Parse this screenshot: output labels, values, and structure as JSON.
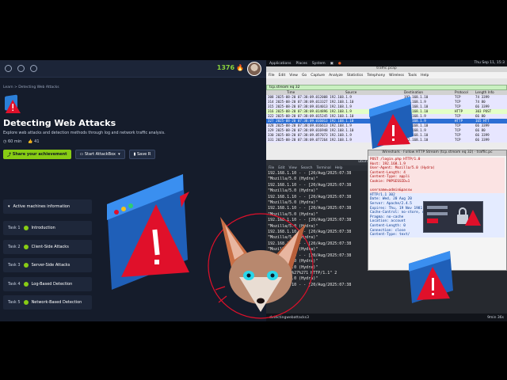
{
  "left": {
    "streak_count": "1376",
    "breadcrumb": "Learn > Detecting Web Attacks",
    "title": "Detecting Web Attacks",
    "description": "Explore web attacks and detection methods through log and network traffic analysis.",
    "duration": "60 min",
    "rating_count": "41",
    "share_label": "Share your achievement",
    "attackbox_label": "Start AttackBox",
    "save_label": "Save R",
    "active_machines_label": "Active machines information",
    "tasks": [
      {
        "num": "Task 1",
        "label": "Introduction"
      },
      {
        "num": "Task 2",
        "label": "Client-Side Attacks"
      },
      {
        "num": "Task 3",
        "label": "Server-Side Attacks"
      },
      {
        "num": "Task 4",
        "label": "Log-Based Detection"
      },
      {
        "num": "Task 5",
        "label": "Network-Based Detection"
      }
    ]
  },
  "kali": {
    "menu": [
      "Applications",
      "Places",
      "System"
    ],
    "clock": "Thu Sep 11, 15:3",
    "wireshark_title": "traffic.pcap",
    "ws_menu": [
      "File",
      "Edit",
      "View",
      "Go",
      "Capture",
      "Analyze",
      "Statistics",
      "Telephony",
      "Wireless",
      "Tools",
      "Help"
    ],
    "filter": "tcp.stream eq 32",
    "columns": [
      "Time",
      "Source",
      "Destination",
      "Protocol",
      "Length Info"
    ],
    "packets": [
      {
        "time": "308 2025-08-20 07:38:09.012008 192.168.1.9",
        "dst": "192.168.1.10",
        "proto": "TCP",
        "len": "74 3399",
        "kind": "tcp"
      },
      {
        "time": "314 2025-08-20 07:38:09.013327 192.168.1.10",
        "dst": "192.168.1.9",
        "proto": "TCP",
        "len": "74 80",
        "kind": "tcp"
      },
      {
        "time": "315 2025-08-20 07:38:09.014013 192.168.1.9",
        "dst": "192.168.1.10",
        "proto": "TCP",
        "len": "66 3399",
        "kind": "tcp"
      },
      {
        "time": "316 2025-08-20 07:38:09.014896 192.168.1.9",
        "dst": "192.168.1.10",
        "proto": "HTTP",
        "len": "303 POST",
        "kind": "http"
      },
      {
        "time": "322 2025-08-20 07:38:09.015245 192.168.1.10",
        "dst": "192.168.1.9",
        "proto": "TCP",
        "len": "66 80",
        "kind": "tcp"
      },
      {
        "time": "327 2025-08-20 07:38:09.016013 192.168.1.10",
        "dst": "192.168.1.9",
        "proto": "HTTP",
        "len": "165 HTT",
        "kind": "sel"
      },
      {
        "time": "328 2025-08-20 07:38:09.016613 192.168.1.9",
        "dst": "192.168.1.10",
        "proto": "TCP",
        "len": "66 3399",
        "kind": "tcp"
      },
      {
        "time": "329 2025-08-20 07:38:09.016948 192.168.1.10",
        "dst": "192.168.1.9",
        "proto": "TCP",
        "len": "66 80",
        "kind": "tcp"
      },
      {
        "time": "330 2025-08-20 07:38:09.057073 192.168.1.9",
        "dst": "192.168.1.10",
        "proto": "TCP",
        "len": "66 3399",
        "kind": "tcp"
      },
      {
        "time": "331 2025-08-20 07:38:09.077264 192.168.1.9",
        "dst": "192.168.1.10",
        "proto": "TCP",
        "len": "66 3399",
        "kind": "tcp"
      }
    ],
    "terminal_title": "ubuntu@tryhackme: ~/Desktop",
    "terminal_menu": [
      "File",
      "Edit",
      "View",
      "Search",
      "Terminal",
      "Help"
    ],
    "log_lines": [
      "192.168.1.10 - - [20/Aug/2025:07:38",
      "\"Mozilla/5.0 (Hydra)\"",
      "192.168.1.10 - - [20/Aug/2025:07:38",
      "\"Mozilla/5.0 (Hydra)\"",
      "192.168.1.10 - - [20/Aug/2025:07:38",
      "\"Mozilla/5.0 (Hydra)\"",
      "192.168.1.10 - - [20/Aug/2025:07:38",
      "\"Mozilla/5.0 (Hydra)\"",
      "192.168.1.10 - - [20/Aug/2025:07:38",
      "\"Mozilla/5.0 (Hydra)\"",
      "192.168.1.10 - - [20/Aug/2025:07:38",
      "\"Mozilla/5.0 (Hydra)\"",
      "192.168.1.10 - - [20/Aug/2025:07:38",
      "\"Mozilla/5.0 (Hydra)\"",
      "192.168.1.10 - - [20/Aug/2025:07:38",
      "\"Mozilla/5.0 (Hydra)\"",
      "\"Mozilla/5.0 (Hydra)\"",
      "+OR+%27%3D%27%271 HTTP/1.1\" 2",
      "\"Mozilla/5.0 (Hydra)\"",
      "192.168.1.10 - - [20/Aug/2025:07:38"
    ],
    "stream_title": "Wireshark · Follow HTTP Stream (tcp.stream eq 32) · traffic.pc",
    "stream_request": [
      "POST /login.php HTTP/1.0",
      "Host: 192.168.1.9",
      "User-Agent: Mozilla/5.0 (Hydra)",
      "Content-Length: 4",
      "Content-Type: appli",
      "Cookie: PHPSESSID=1",
      "",
      "username=admin&passw"
    ],
    "stream_response": [
      "HTTP/1.1 302",
      "Date: Wed, 20 Aug 20",
      "Server: Apache/2.4.5",
      "Expires: Thu, 19 Nov 1981 08:52:00 GMT",
      "Cache-Control: no-store, no-cache, must-revalida",
      "Pragma: no-cache",
      "Location: account",
      "Content-Length: 0",
      "Connection: close",
      "Content-Type: text/"
    ],
    "taskbar_item": "detectingwebattacks3",
    "time_left": "9min 36s"
  },
  "colors": {
    "accent": "#88cc14",
    "alert": "#e0102a",
    "window_blue": "#2b7fd8"
  }
}
